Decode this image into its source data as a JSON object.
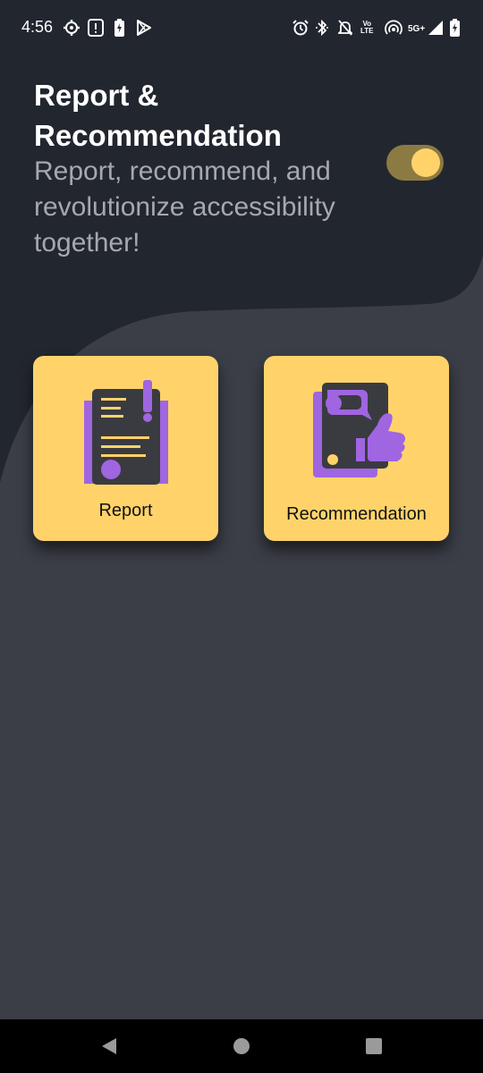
{
  "status_bar": {
    "time": "4:56",
    "network": "5G+",
    "volte_line1": "Vo",
    "volte_line2": "LTE",
    "icons": [
      "settings-gear-icon",
      "alert-box-icon",
      "battery-saver-icon",
      "play-store-icon",
      "alarm-icon",
      "bluetooth-icon",
      "notifications-off-icon",
      "volte-icon",
      "hotspot-icon",
      "signal-icon",
      "battery-icon"
    ]
  },
  "header": {
    "title": "Report & Recommendation",
    "subtitle": "Report, recommend, and revolutionize accessibility together!"
  },
  "toggle": {
    "state": "on"
  },
  "cards": {
    "report": {
      "label": "Report",
      "icon": "report-document-icon"
    },
    "recommendation": {
      "label": "Recommendation",
      "icon": "recommendation-thumbs-up-icon"
    }
  },
  "nav_bar": {
    "icons": [
      "back-icon",
      "home-icon",
      "recents-icon"
    ]
  },
  "colors": {
    "background": "#3b3e47",
    "header_background": "#22262f",
    "accent": "#ffd36a",
    "icon_purple": "#a065e0",
    "icon_dark": "#3a3b40"
  }
}
